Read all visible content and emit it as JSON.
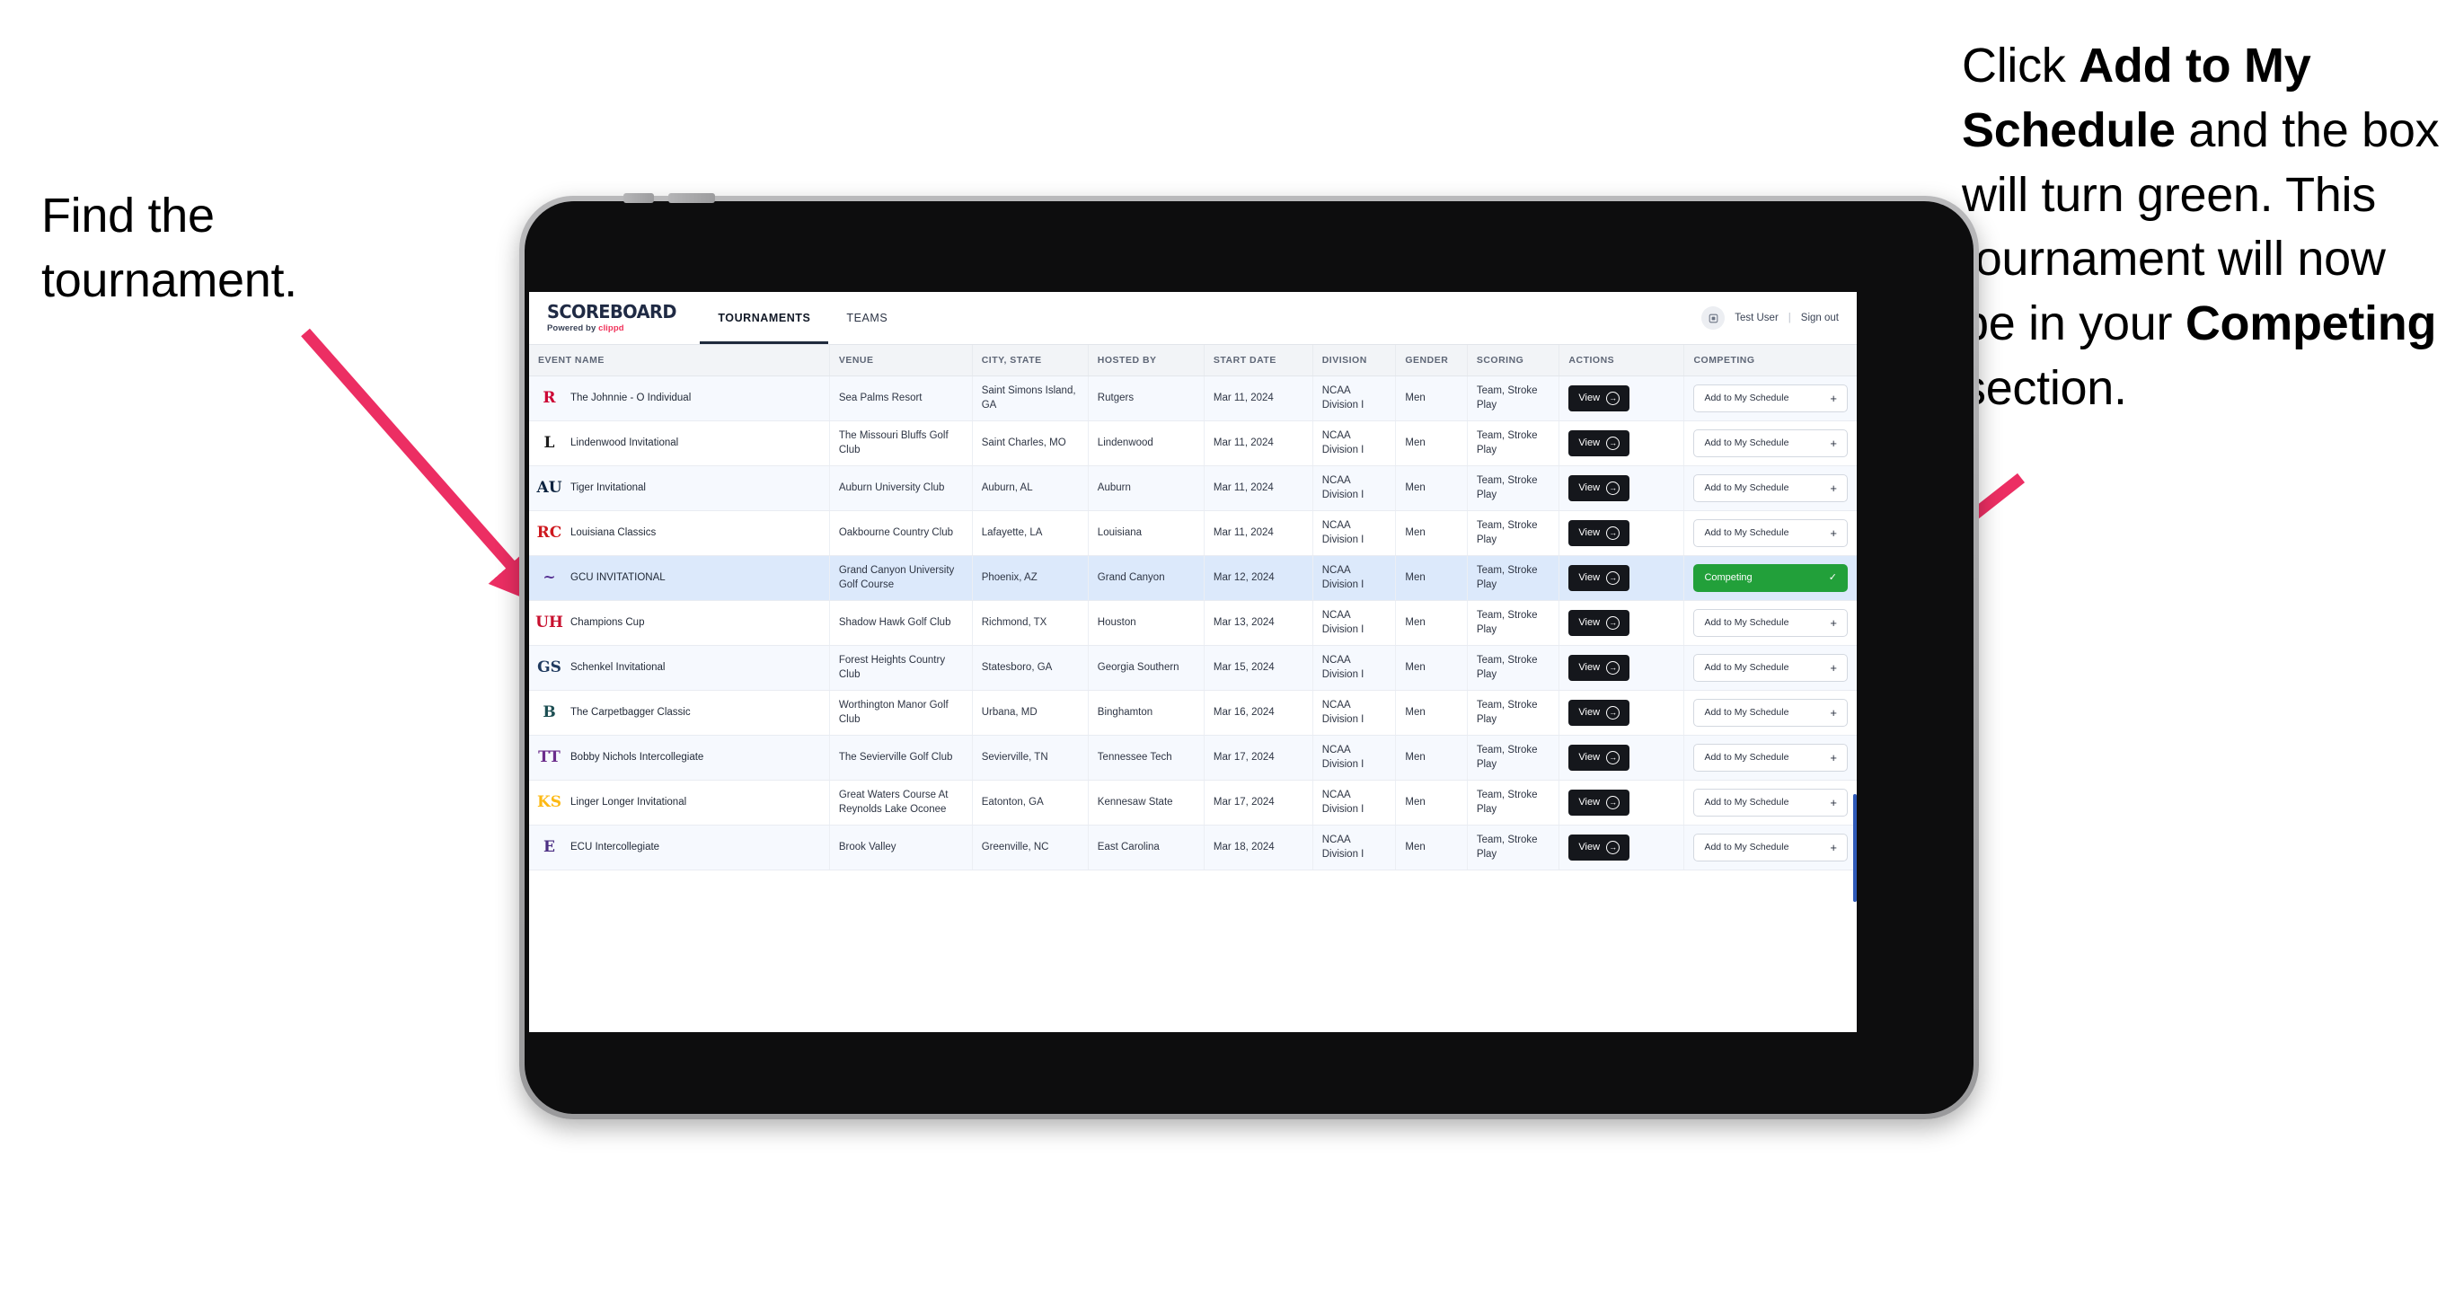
{
  "annotations": {
    "left": {
      "line1": "Find the",
      "line2": "tournament."
    },
    "right": {
      "segments": [
        {
          "text": "Click ",
          "bold": false
        },
        {
          "text": "Add to My Schedule",
          "bold": true
        },
        {
          "text": " and the box will turn green. This tournament will now be in your ",
          "bold": false
        },
        {
          "text": "Competing",
          "bold": true
        },
        {
          "text": " section.",
          "bold": false
        }
      ],
      "full_text": "Click Add to My Schedule and the box will turn green. This tournament will now be in your Competing section."
    },
    "arrow_color": "#ec2e63"
  },
  "app": {
    "brand": {
      "title": "SCOREBOARD",
      "powered_prefix": "Powered by ",
      "powered_name": "clippd",
      "clippd_color": "#f0325a"
    },
    "nav": [
      {
        "label": "TOURNAMENTS",
        "active": true
      },
      {
        "label": "TEAMS",
        "active": false
      }
    ],
    "account": {
      "avatar_icon": "user-badge-icon",
      "user_name": "Test User",
      "divider": "|",
      "sign_out": "Sign out"
    }
  },
  "table": {
    "columns": [
      "EVENT NAME",
      "VENUE",
      "CITY, STATE",
      "HOSTED BY",
      "START DATE",
      "DIVISION",
      "GENDER",
      "SCORING",
      "ACTIONS",
      "COMPETING"
    ],
    "action_labels": {
      "view": "View",
      "view_icon": "arrow-right-circle-icon",
      "add": "Add to My Schedule",
      "add_icon": "plus-icon",
      "competing": "Competing",
      "competing_icon": "check-icon",
      "competing_color": "#22a03a"
    },
    "rows": [
      {
        "logo": {
          "text": "R",
          "color": "#cc0033",
          "bg": "transparent"
        },
        "event": "The Johnnie - O Individual",
        "venue": "Sea Palms Resort",
        "city": "Saint Simons Island, GA",
        "host": "Rutgers",
        "date": "Mar 11, 2024",
        "division": "NCAA Division I",
        "gender": "Men",
        "scoring": "Team, Stroke Play",
        "competing": false,
        "selected": false
      },
      {
        "logo": {
          "text": "L",
          "color": "#1c1c1c",
          "bg": "transparent"
        },
        "event": "Lindenwood Invitational",
        "venue": "The Missouri Bluffs Golf Club",
        "city": "Saint Charles, MO",
        "host": "Lindenwood",
        "date": "Mar 11, 2024",
        "division": "NCAA Division I",
        "gender": "Men",
        "scoring": "Team, Stroke Play",
        "competing": false,
        "selected": false
      },
      {
        "logo": {
          "text": "AU",
          "color": "#0c2340",
          "bg": "transparent"
        },
        "event": "Tiger Invitational",
        "venue": "Auburn University Club",
        "city": "Auburn, AL",
        "host": "Auburn",
        "date": "Mar 11, 2024",
        "division": "NCAA Division I",
        "gender": "Men",
        "scoring": "Team, Stroke Play",
        "competing": false,
        "selected": false
      },
      {
        "logo": {
          "text": "RC",
          "color": "#ce181e",
          "bg": "transparent"
        },
        "event": "Louisiana Classics",
        "venue": "Oakbourne Country Club",
        "city": "Lafayette, LA",
        "host": "Louisiana",
        "date": "Mar 11, 2024",
        "division": "NCAA Division I",
        "gender": "Men",
        "scoring": "Team, Stroke Play",
        "competing": false,
        "selected": false
      },
      {
        "logo": {
          "text": "~",
          "color": "#542e91",
          "bg": "transparent"
        },
        "event": "GCU INVITATIONAL",
        "venue": "Grand Canyon University Golf Course",
        "city": "Phoenix, AZ",
        "host": "Grand Canyon",
        "date": "Mar 12, 2024",
        "division": "NCAA Division I",
        "gender": "Men",
        "scoring": "Team, Stroke Play",
        "competing": true,
        "selected": true
      },
      {
        "logo": {
          "text": "UH",
          "color": "#c8102e",
          "bg": "transparent"
        },
        "event": "Champions Cup",
        "venue": "Shadow Hawk Golf Club",
        "city": "Richmond, TX",
        "host": "Houston",
        "date": "Mar 13, 2024",
        "division": "NCAA Division I",
        "gender": "Men",
        "scoring": "Team, Stroke Play",
        "competing": false,
        "selected": false
      },
      {
        "logo": {
          "text": "GS",
          "color": "#1f3a5f",
          "bg": "transparent"
        },
        "event": "Schenkel Invitational",
        "venue": "Forest Heights Country Club",
        "city": "Statesboro, GA",
        "host": "Georgia Southern",
        "date": "Mar 15, 2024",
        "division": "NCAA Division I",
        "gender": "Men",
        "scoring": "Team, Stroke Play",
        "competing": false,
        "selected": false
      },
      {
        "logo": {
          "text": "B",
          "color": "#1c4e52",
          "bg": "transparent"
        },
        "event": "The Carpetbagger Classic",
        "venue": "Worthington Manor Golf Club",
        "city": "Urbana, MD",
        "host": "Binghamton",
        "date": "Mar 16, 2024",
        "division": "NCAA Division I",
        "gender": "Men",
        "scoring": "Team, Stroke Play",
        "competing": false,
        "selected": false
      },
      {
        "logo": {
          "text": "TT",
          "color": "#6b2d8c",
          "bg": "transparent"
        },
        "event": "Bobby Nichols Intercollegiate",
        "venue": "The Sevierville Golf Club",
        "city": "Sevierville, TN",
        "host": "Tennessee Tech",
        "date": "Mar 17, 2024",
        "division": "NCAA Division I",
        "gender": "Men",
        "scoring": "Team, Stroke Play",
        "competing": false,
        "selected": false
      },
      {
        "logo": {
          "text": "KS",
          "color": "#fdb913",
          "bg": "transparent"
        },
        "event": "Linger Longer Invitational",
        "venue": "Great Waters Course At Reynolds Lake Oconee",
        "city": "Eatonton, GA",
        "host": "Kennesaw State",
        "date": "Mar 17, 2024",
        "division": "NCAA Division I",
        "gender": "Men",
        "scoring": "Team, Stroke Play",
        "competing": false,
        "selected": false
      },
      {
        "logo": {
          "text": "E",
          "color": "#4b2e83",
          "bg": "transparent"
        },
        "event": "ECU Intercollegiate",
        "venue": "Brook Valley",
        "city": "Greenville, NC",
        "host": "East Carolina",
        "date": "Mar 18, 2024",
        "division": "NCAA Division I",
        "gender": "Men",
        "scoring": "Team, Stroke Play",
        "competing": false,
        "selected": false,
        "clipped": true
      }
    ]
  }
}
